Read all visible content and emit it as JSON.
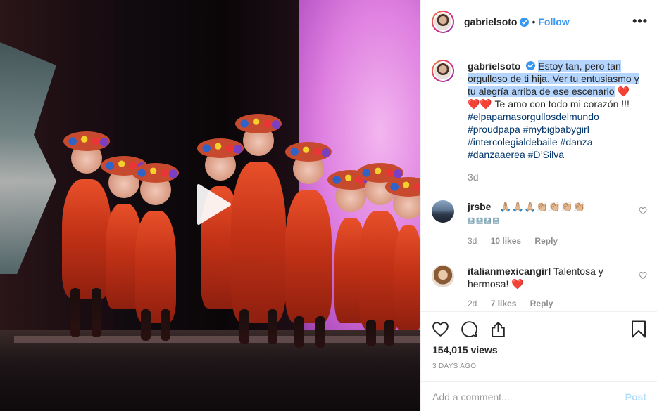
{
  "video": {
    "play_icon": "play-icon"
  },
  "header": {
    "username": "gabrielsoto",
    "separator": "•",
    "follow_label": "Follow",
    "more_label": "•••"
  },
  "caption": {
    "username": "gabrielsoto",
    "text_highlighted": "Estoy tan, pero tan orgulloso de ti hija. Ver tu entusiasmo y tu alegría arriba de ese escenario",
    "line2": "Te amo con todo mi corazón !!!",
    "hashtags": [
      "#elpapamasorgullosdelmundo",
      "#proudpapa",
      "#mybigbabygirl",
      "#intercolegialdebaile",
      "#danza",
      "#danzaaerea",
      "#D’Silva"
    ],
    "time": "3d"
  },
  "comments": [
    {
      "username": "jrsbe_",
      "text": "🙏🏼🙏🏼🙏🏼👏🏼👏🏼👏🏼👏🏼",
      "tops": "🔝🔝🔝🔝",
      "time": "3d",
      "likes": "10 likes",
      "reply": "Reply"
    },
    {
      "username": "italianmexicangirl",
      "text": "Talentosa y hermosa!",
      "time": "2d",
      "likes": "7 likes",
      "reply": "Reply"
    }
  ],
  "stats": {
    "views": "154,015 views",
    "posted": "3 DAYS AGO"
  },
  "add_comment": {
    "placeholder": "Add a comment...",
    "post_label": "Post"
  },
  "colors": {
    "link_blue": "#3897f0",
    "hashtag_blue": "#003569",
    "heart_red": "#ed1e24",
    "muted": "#8e8e8e",
    "post_disabled": "#b2dffc",
    "highlight": "#b4d5fe"
  }
}
